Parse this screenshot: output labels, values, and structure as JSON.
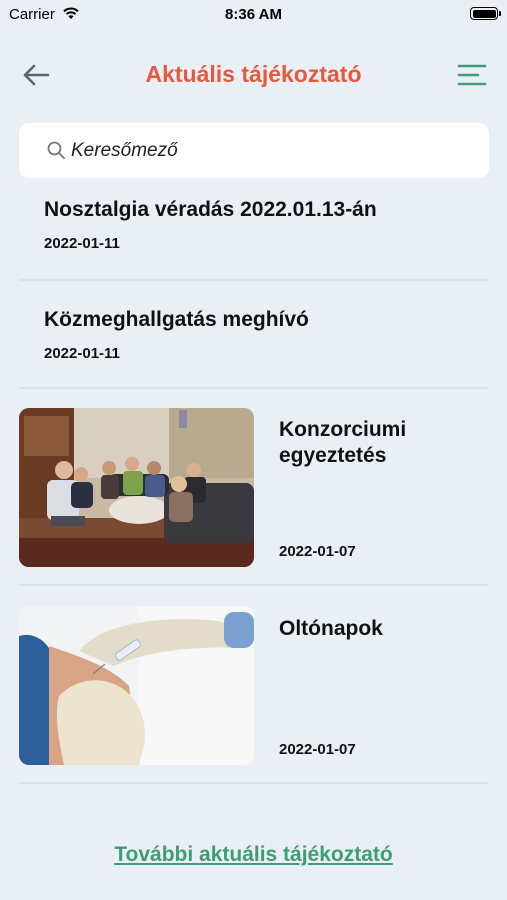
{
  "status": {
    "carrier": "Carrier",
    "time": "8:36 AM"
  },
  "nav": {
    "title": "Aktuális tájékoztató"
  },
  "search": {
    "placeholder": "Keresőmező"
  },
  "news": [
    {
      "title": "Nosztalgia véradás 2022.01.13-án",
      "date": "2022-01-11"
    },
    {
      "title": "Közmeghallgatás meghívó",
      "date": "2022-01-11"
    },
    {
      "title": "Konzorciumi egyeztetés",
      "date": "2022-01-07",
      "image": "meeting-photo"
    },
    {
      "title": "Oltónapok",
      "date": "2022-01-07",
      "image": "vaccination-photo"
    }
  ],
  "more_link": "További aktuális tájékoztató",
  "colors": {
    "accent_title": "#e8593c",
    "link": "#3d9d74",
    "menu_icon": "#3d9d74",
    "background": "#e9eff5"
  }
}
